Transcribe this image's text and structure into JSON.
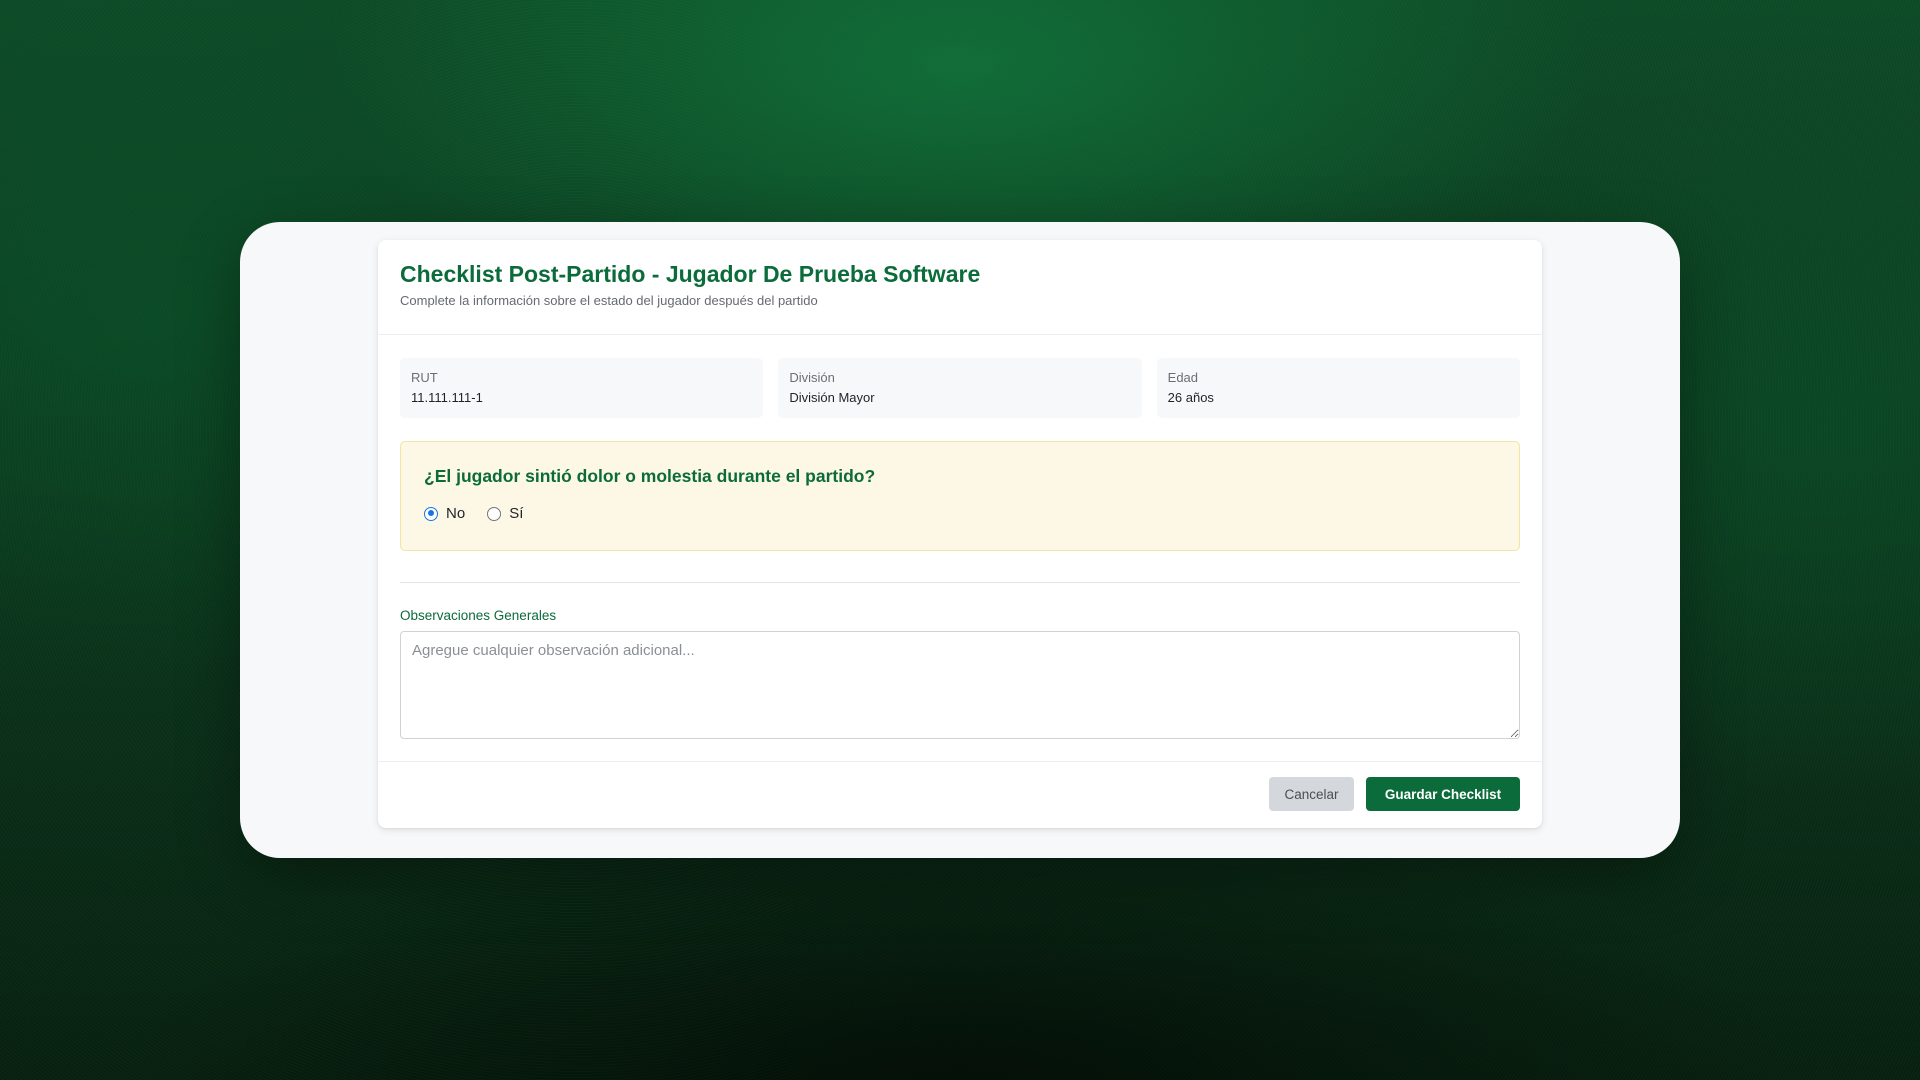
{
  "colors": {
    "brand_green": "#0b6b3a",
    "warning_bg": "#fdf8e6",
    "radio_accent": "#1a73e8",
    "cancel_bg": "#d4d7db"
  },
  "header": {
    "title": "Checklist Post-Partido - Jugador De Prueba Software",
    "subtitle": "Complete la información sobre el estado del jugador después del partido"
  },
  "player_info": [
    {
      "label": "RUT",
      "value": "11.111.111-1"
    },
    {
      "label": "División",
      "value": "División Mayor"
    },
    {
      "label": "Edad",
      "value": "26 años"
    }
  ],
  "pain_question": {
    "text": "¿El jugador sintió dolor o molestia durante el partido?",
    "options": [
      {
        "label": "No",
        "checked": true
      },
      {
        "label": "Sí",
        "checked": false
      }
    ]
  },
  "observations": {
    "label": "Observaciones Generales",
    "placeholder": "Agregue cualquier observación adicional...",
    "value": ""
  },
  "footer": {
    "cancel_label": "Cancelar",
    "save_label": "Guardar Checklist"
  }
}
